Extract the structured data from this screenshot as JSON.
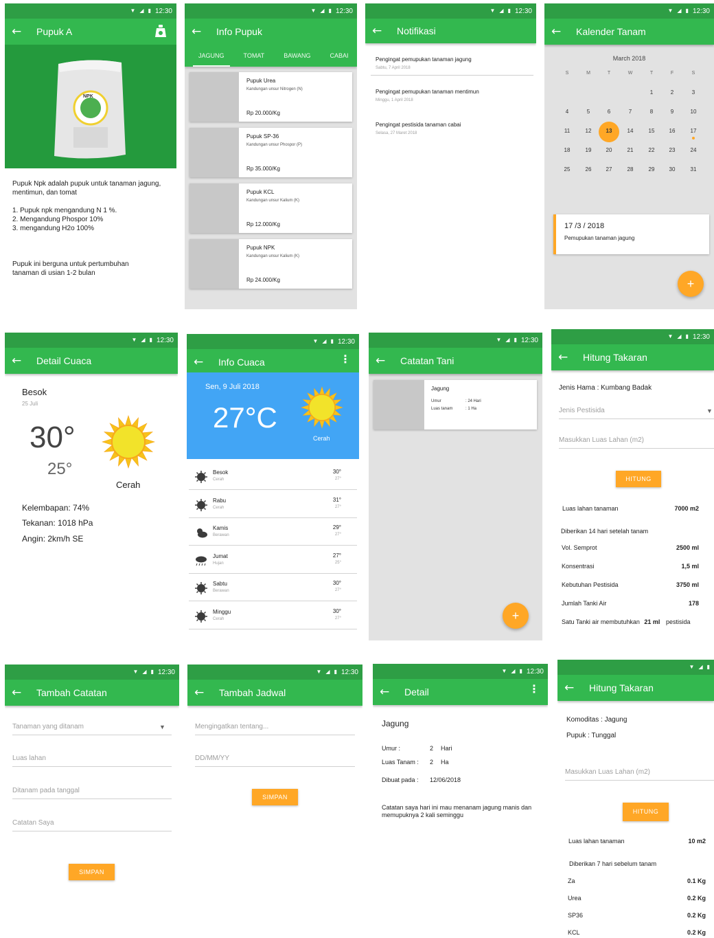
{
  "status_time": "12:30",
  "pupuk_a": {
    "title": "Pupuk A",
    "desc1": "Pupuk Npk adalah pupuk untuk tanaman jagung, mentimun, dan tomat",
    "list": [
      "1. Pupuk npk mengandung N 1 %.",
      "2. Mengandung Phospor 10%",
      "3. mengandung H2o 100%"
    ],
    "desc2": "Pupuk ini berguna untuk pertumbuhan tanaman di usian 1-2 bulan",
    "bag_label": "NPK"
  },
  "info_pupuk": {
    "title": "Info Pupuk",
    "tabs": [
      "JAGUNG",
      "TOMAT",
      "BAWANG",
      "CABAI"
    ],
    "items": [
      {
        "name": "Pupuk Urea",
        "desc": "Kandungan unsur Nitrogen (N)",
        "price": "Rp 20.000/Kg"
      },
      {
        "name": "Pupuk SP-36",
        "desc": "Kandungan unsur Phospor (P)",
        "price": "Rp 35.000/Kg"
      },
      {
        "name": "Pupuk KCL",
        "desc": "Kandungan unsur Kalium (K)",
        "price": "Rp 12.000/Kg"
      },
      {
        "name": "Pupuk NPK",
        "desc": "Kandungan unsur Kalium (K)",
        "price": "Rp 24.000/Kg"
      }
    ]
  },
  "notifikasi": {
    "title": "Notifikasi",
    "items": [
      {
        "text": "Pengingat pemupukan tanaman jagung",
        "date": "Sabtu, 7 April 2018"
      },
      {
        "text": "Pengingat pemupukan tanaman mentimun",
        "date": "Minggu, 1 April 2018"
      },
      {
        "text": "Pengingat pestisida tanaman cabai",
        "date": "Selasa, 27 Maret 2018"
      }
    ]
  },
  "kalender": {
    "title": "Kalender Tanam",
    "month": "March 2018",
    "weekdays": [
      "S",
      "M",
      "T",
      "W",
      "T",
      "F",
      "S"
    ],
    "days": [
      "1",
      "2",
      "3",
      "4",
      "5",
      "6",
      "7",
      "8",
      "9",
      "10",
      "11",
      "12",
      "13",
      "14",
      "15",
      "16",
      "17",
      "18",
      "19",
      "20",
      "21",
      "22",
      "23",
      "24",
      "25",
      "26",
      "27",
      "28",
      "29",
      "30",
      "31"
    ],
    "selected": "13",
    "event_date": "17 /3 / 2018",
    "event_text": "Pemupukan tanaman jagung",
    "fab": "+"
  },
  "detail_cuaca": {
    "title": "Detail Cuaca",
    "day": "Besok",
    "date": "25 Juli",
    "high": "30°",
    "low": "25°",
    "condition": "Cerah",
    "humidity": "Kelembapan: 74%",
    "pressure": "Tekanan: 1018 hPa",
    "wind": "Angin: 2km/h SE"
  },
  "info_cuaca": {
    "title": "Info Cuaca",
    "date": "Sen, 9 Juli 2018",
    "temp": "27",
    "temp_unit": "°C",
    "condition": "Cerah",
    "forecast": [
      {
        "day": "Besok",
        "cond": "Cerah",
        "high": "30°",
        "low": "27°",
        "icon": "sun-icon"
      },
      {
        "day": "Rabu",
        "cond": "Cerah",
        "high": "31°",
        "low": "27°",
        "icon": "sun-icon"
      },
      {
        "day": "Kamis",
        "cond": "Berawan",
        "high": "29°",
        "low": "27°",
        "icon": "cloud-sun-icon"
      },
      {
        "day": "Jumat",
        "cond": "Hujan",
        "high": "27°",
        "low": "25°",
        "icon": "rain-icon"
      },
      {
        "day": "Sabtu",
        "cond": "Berawan",
        "high": "30°",
        "low": "27°",
        "icon": "sun-icon"
      },
      {
        "day": "Minggu",
        "cond": "Cerah",
        "high": "30°",
        "low": "27°",
        "icon": "sun-icon"
      }
    ]
  },
  "catatan_tani": {
    "title": "Catatan Tani",
    "item": {
      "name": "Jagung",
      "umur_label": "Umur",
      "umur_val": ": 24 Hari",
      "luas_label": "Luas tanam",
      "luas_val": ": 1 Ha"
    },
    "fab": "+"
  },
  "hitung1": {
    "title": "Hitung Takaran",
    "hama": "Jenis Hama : Kumbang Badak",
    "pestisida_placeholder": "Jenis Pestisida",
    "luas_placeholder": "Masukkan Luas Lahan (m2)",
    "button": "HITUNG",
    "luas_label": "Luas lahan tanaman",
    "luas_val": "7000 m2",
    "given": "Diberikan 14 hari setelah tanam",
    "rows": [
      {
        "label": "Vol. Semprot",
        "val": "2500 ml"
      },
      {
        "label": "Konsentrasi",
        "val": "1,5 ml"
      },
      {
        "label": "Kebutuhan Pestisida",
        "val": "3750 ml"
      },
      {
        "label": "Jumlah Tanki Air",
        "val": "178"
      }
    ],
    "tank_a": "Satu Tanki air membutuhkan",
    "tank_b": "21 ml",
    "tank_c": "pestisida"
  },
  "tambah_catatan": {
    "title": "Tambah Catatan",
    "fields": [
      "Tanaman yang ditanam",
      "Luas lahan",
      "Ditanam pada tanggal",
      "Catatan Saya"
    ],
    "button": "SIMPAN"
  },
  "tambah_jadwal": {
    "title": "Tambah Jadwal",
    "fields": [
      "Mengingatkan tentang...",
      "DD/MM/YY"
    ],
    "button": "SIMPAN"
  },
  "detail": {
    "title": "Detail",
    "name": "Jagung",
    "umur_label": "Umur :",
    "umur_val": "2",
    "umur_unit": "Hari",
    "luas_label": "Luas Tanam :",
    "luas_val": "2",
    "luas_unit": "Ha",
    "dibuat_label": "Dibuat pada :",
    "dibuat_val": "12/06/2018",
    "note": "Catatan saya hari ini mau menanam jagung manis dan memupuknya 2 kali seminggu"
  },
  "hitung2": {
    "title": "Hitung Takaran",
    "komoditas": "Komoditas : Jagung",
    "pupuk": "Pupuk : Tunggal",
    "luas_placeholder": "Masukkan Luas Lahan (m2)",
    "button": "HITUNG",
    "luas_label": "Luas lahan tanaman",
    "luas_val": "10 m2",
    "given": "Diberikan 7 hari sebelum tanam",
    "rows": [
      {
        "label": "Za",
        "val": "0.1 Kg"
      },
      {
        "label": "Urea",
        "val": "0.2 Kg"
      },
      {
        "label": "SP36",
        "val": "0.2 Kg"
      },
      {
        "label": "KCL",
        "val": "0.2 Kg"
      }
    ]
  },
  "colors": {
    "primary": "#33b84f",
    "primary_dark": "#2e9e45",
    "accent": "#ffa726",
    "sky": "#42a5f5"
  }
}
